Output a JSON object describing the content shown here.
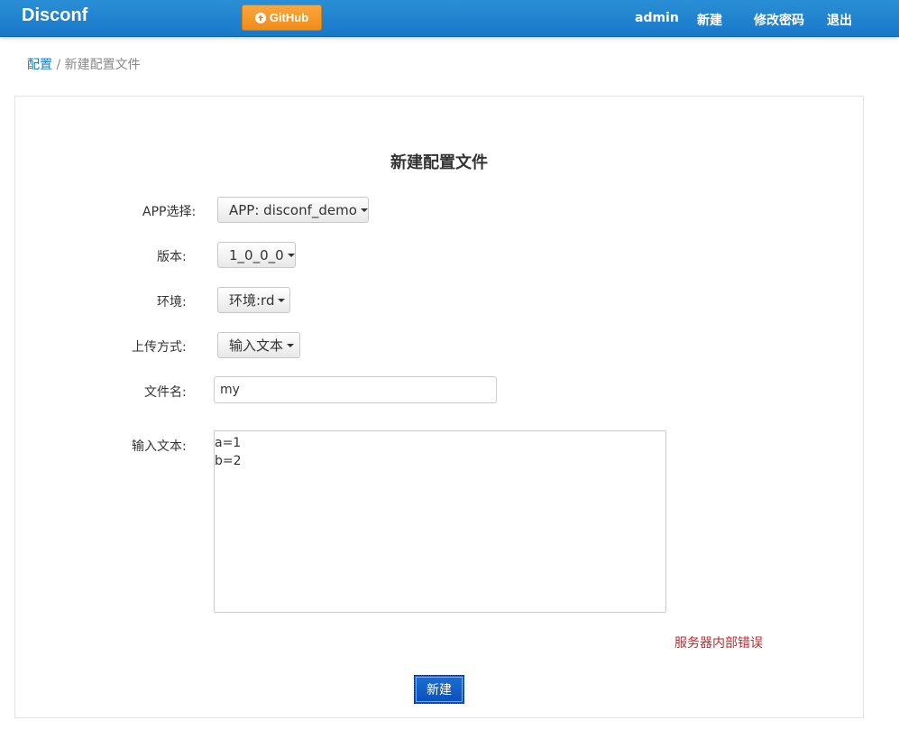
{
  "navbar": {
    "brand": "Disconf",
    "github_label": "GitHub",
    "links": [
      "admin",
      "新建",
      "修改密码",
      "退出"
    ]
  },
  "breadcrumb": {
    "parent": "配置",
    "separator": "/",
    "current": "新建配置文件"
  },
  "form": {
    "title": "新建配置文件",
    "app": {
      "label": "APP选择:",
      "value": "APP: disconf_demo"
    },
    "version": {
      "label": "版本:",
      "value": "1_0_0_0"
    },
    "env": {
      "label": "环境:",
      "value": "环境:rd"
    },
    "upload": {
      "label": "上传方式:",
      "value": "输入文本"
    },
    "filename": {
      "label": "文件名:",
      "value": "my"
    },
    "content": {
      "label": "输入文本:",
      "value": "a=1\nb=2"
    },
    "error": "服务器内部错误",
    "submit_label": "新建"
  },
  "colors": {
    "navbar": "#1878c9",
    "github": "#f08c1a",
    "error": "#c0272d",
    "submit": "#0a4fb8"
  }
}
